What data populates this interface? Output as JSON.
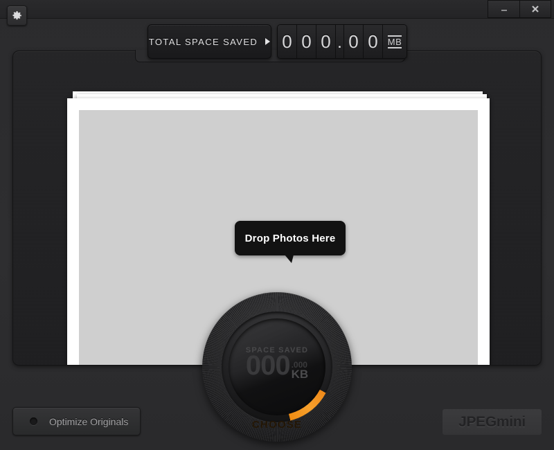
{
  "window": {
    "app_name": "JPEGmini",
    "minimize_label": "minimize",
    "close_label": "close"
  },
  "toolbar": {
    "settings_icon": "gear-icon"
  },
  "counter": {
    "label": "TOTAL SPACE SAVED",
    "arrow": "▶",
    "digits": [
      "0",
      "0",
      "0",
      ".",
      "0",
      "0"
    ],
    "unit": "MB"
  },
  "dropzone": {
    "bubble_text": "Drop Photos Here"
  },
  "dial": {
    "label": "SPACE SAVED",
    "value": "000",
    "decimals": ".000",
    "unit": "KB",
    "button_label": "CHOOSE",
    "accent_color": "#f08a1a"
  },
  "footer": {
    "optimize_label": "Optimize Originals",
    "logo_text": "JPEGmini"
  }
}
